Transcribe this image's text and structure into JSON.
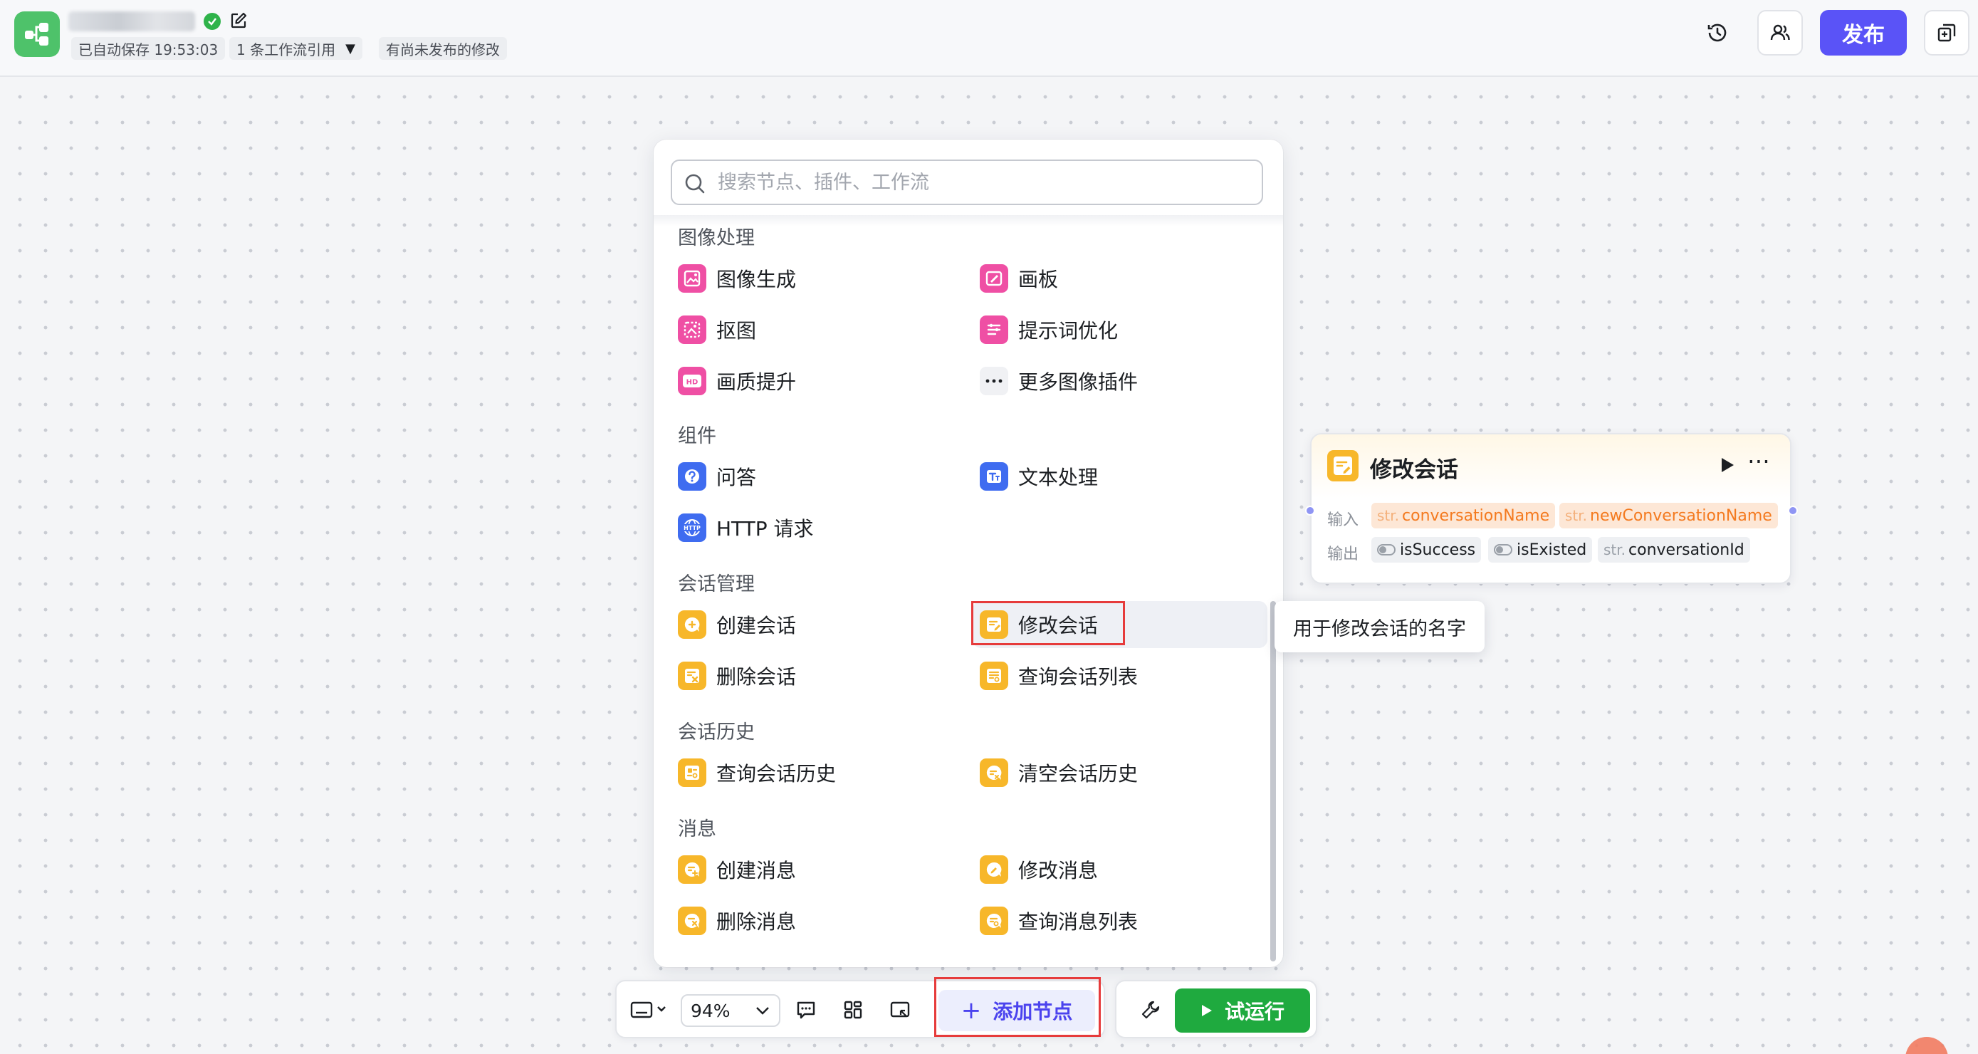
{
  "header": {
    "save_status": "已自动保存 19:53:03",
    "workflow_refs": "1 条工作流引用",
    "unpublished": "有尚未发布的修改",
    "publish_label": "发布"
  },
  "panel": {
    "search_placeholder": "搜索节点、插件、工作流",
    "sections": [
      {
        "title": "图像处理",
        "items": [
          "图像生成",
          "画板",
          "抠图",
          "提示词优化",
          "画质提升",
          "更多图像插件"
        ]
      },
      {
        "title": "组件",
        "items": [
          "问答",
          "文本处理",
          "HTTP 请求"
        ]
      },
      {
        "title": "会话管理",
        "items": [
          "创建会话",
          "修改会话",
          "删除会话",
          "查询会话列表"
        ]
      },
      {
        "title": "会话历史",
        "items": [
          "查询会话历史",
          "清空会话历史"
        ]
      },
      {
        "title": "消息",
        "items": [
          "创建消息",
          "修改消息",
          "删除消息",
          "查询消息列表"
        ]
      }
    ],
    "tooltip": "用于修改会话的名字"
  },
  "wf_node": {
    "title": "修改会话",
    "input_label": "输入",
    "output_label": "输出",
    "inputs": [
      {
        "type": "str.",
        "name": "conversationName"
      },
      {
        "type": "str.",
        "name": "newConversationName"
      }
    ],
    "outputs": [
      {
        "type": "",
        "name": "isSuccess"
      },
      {
        "type": "",
        "name": "isExisted"
      },
      {
        "type": "str.",
        "name": "conversationId"
      }
    ]
  },
  "toolbar": {
    "zoom": "94%",
    "add_node": "添加节点",
    "test_run": "试运行"
  },
  "colors": {
    "accent": "#5a53f7",
    "run_green": "#1faa3f",
    "highlight_red": "#e63b3b",
    "node_yellow": "#f7b72a",
    "image_pink": "#ef4fa4",
    "component_blue": "#3f6cf0"
  }
}
